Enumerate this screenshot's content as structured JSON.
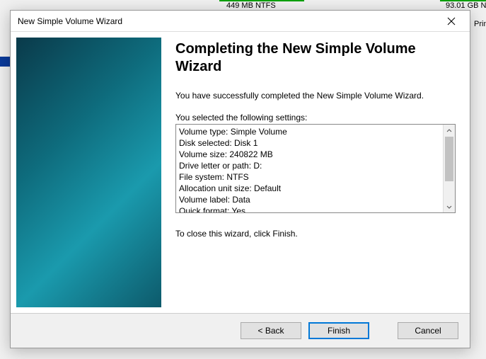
{
  "background": {
    "partition1": "449 MB NTFS",
    "partition2_size": "93.01 GB",
    "partition2_fs": "NT",
    "partition2_type_partial": "Prin"
  },
  "dialog": {
    "title": "New Simple Volume Wizard",
    "heading": "Completing the New Simple Volume Wizard",
    "success_text": "You have successfully completed the New Simple Volume Wizard.",
    "settings_label": "You selected the following settings:",
    "settings": [
      "Volume type: Simple Volume",
      "Disk selected: Disk 1",
      "Volume size: 240822 MB",
      "Drive letter or path: D:",
      "File system: NTFS",
      "Allocation unit size: Default",
      "Volume label: Data",
      "Quick format: Yes"
    ],
    "closing_text": "To close this wizard, click Finish.",
    "buttons": {
      "back": "< Back",
      "finish": "Finish",
      "cancel": "Cancel"
    }
  }
}
